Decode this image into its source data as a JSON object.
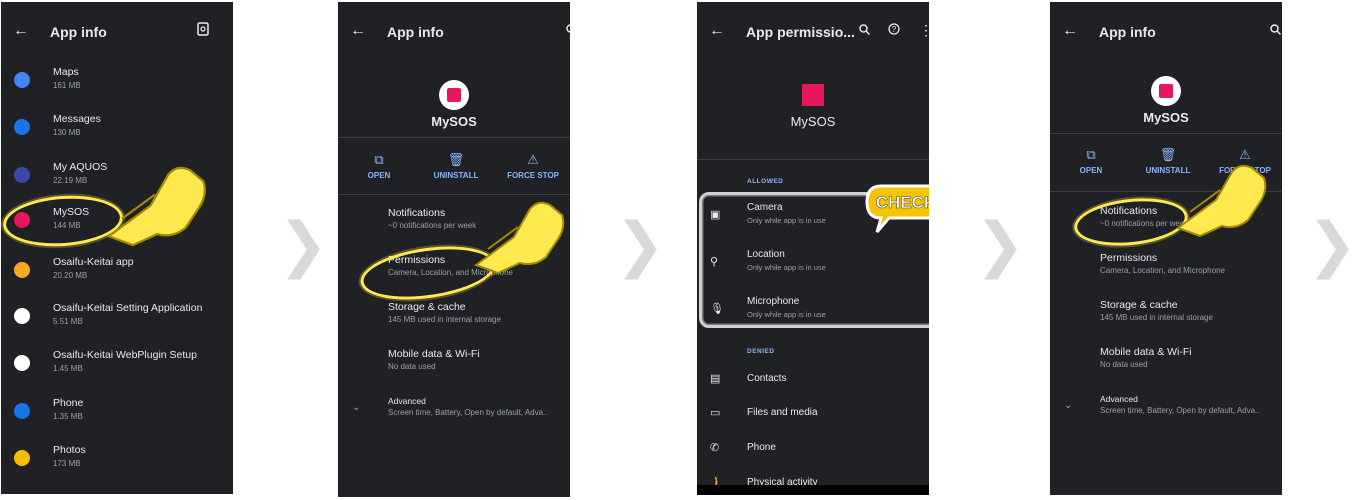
{
  "screen1": {
    "title": "App info",
    "apps": [
      {
        "name": "Maps",
        "size": "161 MB",
        "color": "#4285f4"
      },
      {
        "name": "Messages",
        "size": "130 MB",
        "color": "#1a73e8"
      },
      {
        "name": "My AQUOS",
        "size": "22.19 MB",
        "color": "#3949ab"
      },
      {
        "name": "MySOS",
        "size": "144 MB",
        "color": "#e8175d"
      },
      {
        "name": "Osaifu-Keitai app",
        "size": "20.20 MB",
        "color": "#f9a825"
      },
      {
        "name": "Osaifu-Keitai Setting Application",
        "size": "5.51 MB",
        "color": "#ffffff"
      },
      {
        "name": "Osaifu-Keitai WebPlugin Setup",
        "size": "1.45 MB",
        "color": "#ffffff"
      },
      {
        "name": "Phone",
        "size": "1.35 MB",
        "color": "#1a73e8"
      },
      {
        "name": "Photos",
        "size": "173 MB",
        "color": "#fbbc04"
      }
    ]
  },
  "screen2": {
    "title": "App info",
    "app_name": "MySOS",
    "actions": [
      "OPEN",
      "UNINSTALL",
      "FORCE STOP"
    ],
    "prefs": [
      {
        "title": "Notifications",
        "subtitle": "~0 notifications per week"
      },
      {
        "title": "Permissions",
        "subtitle": "Camera, Location, and Microphone"
      },
      {
        "title": "Storage & cache",
        "subtitle": "145 MB used in internal storage"
      },
      {
        "title": "Mobile data & Wi-Fi",
        "subtitle": "No data used"
      },
      {
        "title": "Advanced",
        "subtitle": "Screen time, Battery, Open by default, Adva.."
      }
    ]
  },
  "screen3": {
    "title": "App permissio...",
    "app_name": "MySOS",
    "allowed_label": "ALLOWED",
    "allowed": [
      {
        "title": "Camera",
        "subtitle": "Only while app is in use"
      },
      {
        "title": "Location",
        "subtitle": "Only while app is in use"
      },
      {
        "title": "Microphone",
        "subtitle": "Only while app is in use"
      }
    ],
    "denied_label": "DENIED",
    "denied": [
      "Contacts",
      "Files and media",
      "Phone",
      "Physical activity"
    ],
    "check_label": "CHECK"
  },
  "screen4": {
    "title": "App info",
    "app_name": "MySOS",
    "actions": [
      "OPEN",
      "UNINSTALL",
      "FORCE STOP"
    ],
    "prefs": [
      {
        "title": "Notifications",
        "subtitle": "~0 notifications per week"
      },
      {
        "title": "Permissions",
        "subtitle": "Camera, Location, and Microphone"
      },
      {
        "title": "Storage & cache",
        "subtitle": "145 MB used in internal storage"
      },
      {
        "title": "Mobile data & Wi-Fi",
        "subtitle": "No data used"
      },
      {
        "title": "Advanced",
        "subtitle": "Screen time, Battery, Open by default, Adva.."
      }
    ]
  },
  "colors": {
    "highlight": "#ffe94f",
    "accent": "#8ab4f8",
    "screen_bg": "#202124",
    "arrow": "#d9d9d9"
  }
}
